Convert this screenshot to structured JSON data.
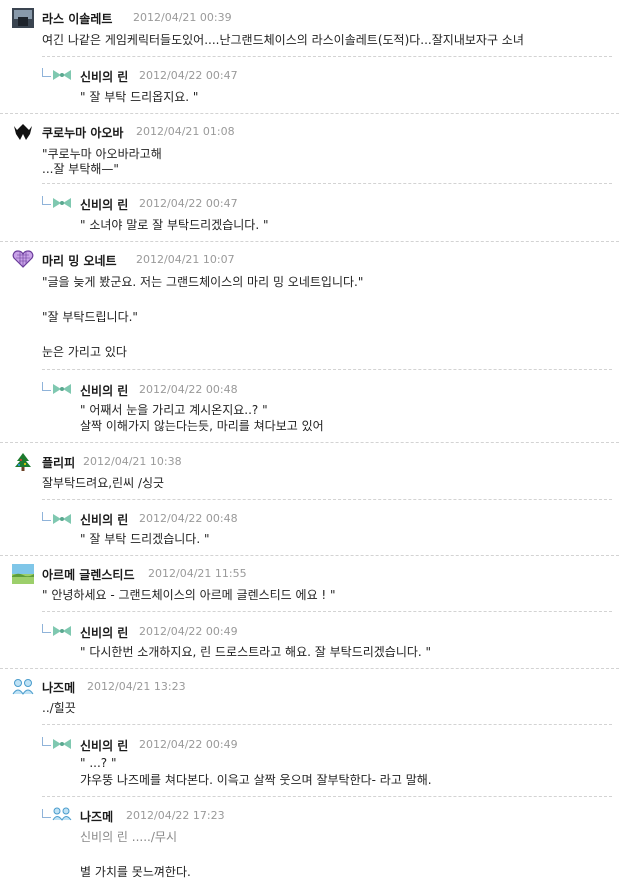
{
  "comments": [
    {
      "name": "라스 이솔레트",
      "date": "2012/04/21 00:39",
      "lines": [
        "여긴 나같은 게임케릭터들도있어....난그랜드체이스의 라스이솔레트(도적)다...잘지내보자구 소녀"
      ],
      "avatar": "dark-portrait-icon",
      "reply": {
        "name": "신비의 린",
        "date": "2012/04/22 00:47",
        "lines": [
          "\" 잘 부탁 드리옵지요. \""
        ]
      }
    },
    {
      "name": "쿠로누마 아오바",
      "date": "2012/04/21 01:08",
      "lines": [
        "\"쿠로누마 아오바라고해",
        "...잘 부탁해—\""
      ],
      "avatar": "black-wings-icon",
      "reply": {
        "name": "신비의 린",
        "date": "2012/04/22 00:47",
        "lines": [
          "\" 소녀야 말로 잘 부탁드리겠습니다. \""
        ]
      }
    },
    {
      "name": "마리 밍 오네트",
      "date": "2012/04/21 10:07",
      "lines": [
        "\"글을 늦게 봤군요. 저는 그랜드체이스의 마리 밍 오네트입니다.\"",
        "",
        "\"잘 부탁드립니다.\"",
        "",
        "눈은 가리고 있다"
      ],
      "avatar": "purple-heart-icon",
      "reply": {
        "name": "신비의 린",
        "date": "2012/04/22 00:48",
        "lines": [
          "\" 어째서 눈을 가리고 계시온지요..? \"",
          "살짝 이해가지 않는다는듯, 마리를 쳐다보고 있어"
        ]
      }
    },
    {
      "name": "플리피",
      "date": "2012/04/21 10:38",
      "lines": [
        "잘부탁드려요,린씨 /싱긋"
      ],
      "avatar": "christmas-tree-icon",
      "reply": {
        "name": "신비의 린",
        "date": "2012/04/22 00:48",
        "lines": [
          "\" 잘 부탁 드리겠습니다. \""
        ]
      }
    },
    {
      "name": "아르메 글렌스티드",
      "date": "2012/04/21 11:55",
      "lines": [
        "\" 안녕하세요 - 그랜드체이스의 아르메 글렌스티드 에요 ! \""
      ],
      "avatar": "landscape-icon",
      "reply": {
        "name": "신비의 린",
        "date": "2012/04/22 00:49",
        "lines": [
          "\" 다시한번 소개하지요, 린 드로스트라고 해요. 잘 부탁드리겠습니다. \""
        ]
      }
    },
    {
      "name": "나즈메",
      "date": "2012/04/21 13:23",
      "lines": [
        "../힐끗"
      ],
      "avatar": "blue-figures-icon",
      "replies": [
        {
          "name": "신비의 린",
          "date": "2012/04/22 00:49",
          "lines": [
            "\" ...? \"",
            "갸우뚱 나즈메를 쳐다본다. 이윽고 살짝 웃으며 잘부탁한다- 라고 말해."
          ]
        },
        {
          "name": "나즈메",
          "date": "2012/04/22 17:23",
          "lines": [
            "신비의 린 ...../무시",
            "",
            "별 가치를 못느껴한다."
          ]
        }
      ]
    }
  ],
  "colors": {
    "name": "#1a1a1a",
    "date": "#9a9a9a",
    "separator": "#d3d3d3",
    "reply_arrow": "#8fb3d9",
    "ribbon": "#7fc8b0"
  }
}
